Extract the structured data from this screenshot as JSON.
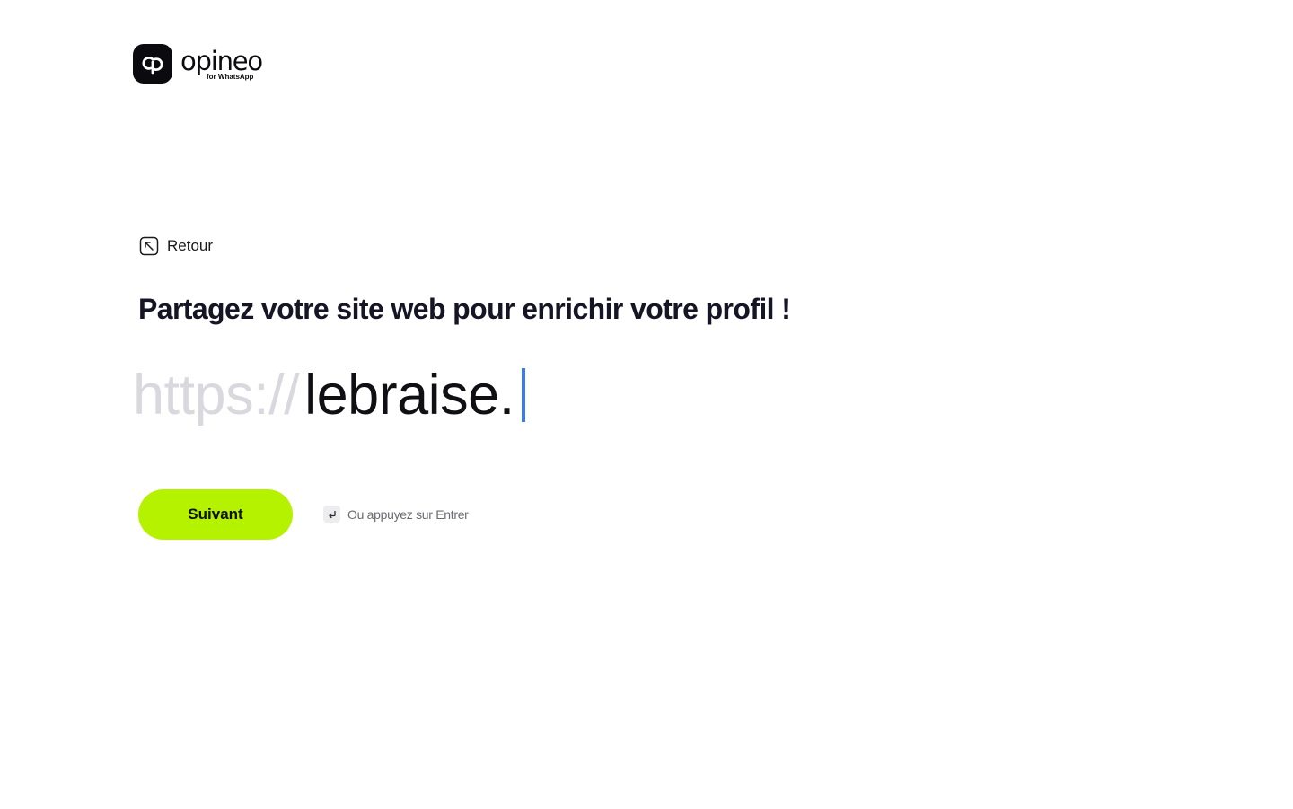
{
  "brand": {
    "name": "opineo",
    "tagline": "for WhatsApp"
  },
  "back": {
    "label": "Retour"
  },
  "question": {
    "title": "Partagez votre site web pour enrichir votre profil !"
  },
  "url_field": {
    "prefix": "https://",
    "value": "lebraise."
  },
  "actions": {
    "next_label": "Suivant",
    "enter_hint": "Ou appuyez sur Entrer"
  },
  "colors": {
    "accent": "#b5f200",
    "caret": "#3b7bf0",
    "prefix": "#d8d8de"
  },
  "icons": {
    "logo": "link-loop-icon",
    "back": "arrow-up-left-square-icon",
    "enter": "enter-return-icon"
  }
}
